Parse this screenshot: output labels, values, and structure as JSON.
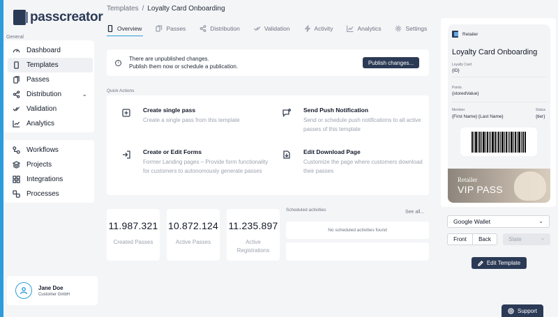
{
  "brand": {
    "name": "passcreator"
  },
  "sidebar": {
    "section_label": "General",
    "items": [
      {
        "label": "Dashboard",
        "icon": "gauge-icon"
      },
      {
        "label": "Templates",
        "icon": "phone-icon",
        "active": true
      },
      {
        "label": "Passes",
        "icon": "passes-icon"
      },
      {
        "label": "Distribution",
        "icon": "share-icon",
        "has_chevron": true
      },
      {
        "label": "Validation",
        "icon": "checkmark-icon"
      },
      {
        "label": "Analytics",
        "icon": "chart-icon"
      }
    ],
    "items2": [
      {
        "label": "Workflows",
        "icon": "workflow-icon"
      },
      {
        "label": "Projects",
        "icon": "layers-icon"
      },
      {
        "label": "Integrations",
        "icon": "grid-icon"
      },
      {
        "label": "Processes",
        "icon": "process-icon"
      }
    ],
    "user": {
      "name": "Jane Doe",
      "org": "Customer GmbH"
    }
  },
  "breadcrumb": {
    "parent": "Templates",
    "separator": "/",
    "current": "Loyalty Card Onboarding"
  },
  "tabs": [
    {
      "label": "Overview",
      "active": true
    },
    {
      "label": "Passes"
    },
    {
      "label": "Distribution"
    },
    {
      "label": "Validation"
    },
    {
      "label": "Activity"
    },
    {
      "label": "Analytics"
    },
    {
      "label": "Settings"
    }
  ],
  "banner": {
    "line1": "There are unpublished changes.",
    "line2": "Publish them now or schedule a publication.",
    "button": "Publish changes..."
  },
  "quick_actions": {
    "label": "Quick Actions",
    "items": [
      {
        "title": "Create single pass",
        "desc": "Create a single pass from this template"
      },
      {
        "title": "Send Push Notification",
        "desc": "Send or schedule push notifications to all active passes of this template"
      },
      {
        "title": "Create or Edit Forms",
        "desc": "Former Landing pages – Provide form functionality for customers to autonomously generate passes"
      },
      {
        "title": "Edit Download Page",
        "desc": "Customize the page where customers download their passes"
      }
    ]
  },
  "stats": [
    {
      "value": "11.987.321",
      "label": "Created Passes"
    },
    {
      "value": "10.872.124",
      "label": "Active Passes"
    },
    {
      "value": "11.235.897",
      "label": "Active Registrations"
    }
  ],
  "scheduled": {
    "label": "Scheduled activities",
    "see_all": "See all...",
    "empty": "No scheduled activities found"
  },
  "pass_preview": {
    "org": "Retailer",
    "title": "Loyalty Card Onboarding",
    "field1_label": "Loyalty Card",
    "field1_value": "{ID}",
    "field2_label": "Points",
    "field2_value": "{storedValue}",
    "member_label": "Member",
    "member_value": "{First Name} {Last Name}",
    "status_label": "Status",
    "status_value": "{tier}",
    "strip_small": "Retailer",
    "strip_big": "VIP PASS"
  },
  "controls": {
    "wallet": "Google Wallet",
    "front": "Front",
    "back": "Back",
    "state": "State",
    "edit": "Edit Template",
    "support": "Support"
  }
}
